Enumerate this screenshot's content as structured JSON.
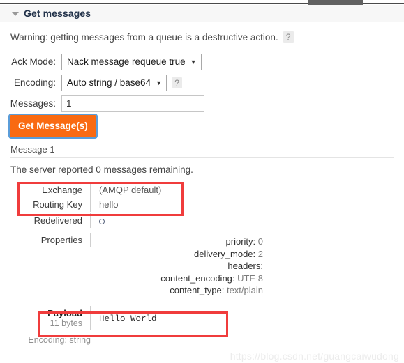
{
  "tabstrip": {
    "active_tab_label": ""
  },
  "section": {
    "title": "Get messages",
    "caret_state": "expanded"
  },
  "warning": {
    "text": "Warning: getting messages from a queue is a destructive action.",
    "help_label": "?"
  },
  "form": {
    "ack_mode": {
      "label": "Ack Mode:",
      "value": "Nack message requeue true",
      "arrow": "▼"
    },
    "encoding": {
      "label": "Encoding:",
      "value": "Auto string / base64",
      "arrow": "▼",
      "help_label": "?"
    },
    "messages": {
      "label": "Messages:",
      "value": "1",
      "placeholder": ""
    },
    "submit_label": "Get Message(s)",
    "submit_color": "#f96a12"
  },
  "result": {
    "message_heading": "Message 1",
    "server_report": "The server reported 0 messages remaining.",
    "rows": [
      {
        "key": "Exchange",
        "value": "(AMQP default)"
      },
      {
        "key": "Routing Key",
        "value": "hello"
      },
      {
        "key": "Redelivered",
        "value": "○"
      },
      {
        "key": "Properties",
        "value": ""
      }
    ],
    "properties": [
      {
        "name": "priority:",
        "value": "0"
      },
      {
        "name": "delivery_mode:",
        "value": "2"
      },
      {
        "name": "headers:",
        "value": ""
      },
      {
        "name": "content_encoding:",
        "value": "UTF-8"
      },
      {
        "name": "content_type:",
        "value": "text/plain"
      }
    ],
    "payload": {
      "key": "Payload",
      "size": "11 bytes",
      "value": "Hello World",
      "encoding_note": "Encoding: string"
    }
  },
  "annotations": {
    "highlight_color": "#f03c3c",
    "boxes": [
      "exchange-routing-key",
      "payload"
    ]
  },
  "watermark": {
    "text": "https://blog.csdn.net/guangcaiwudong"
  }
}
